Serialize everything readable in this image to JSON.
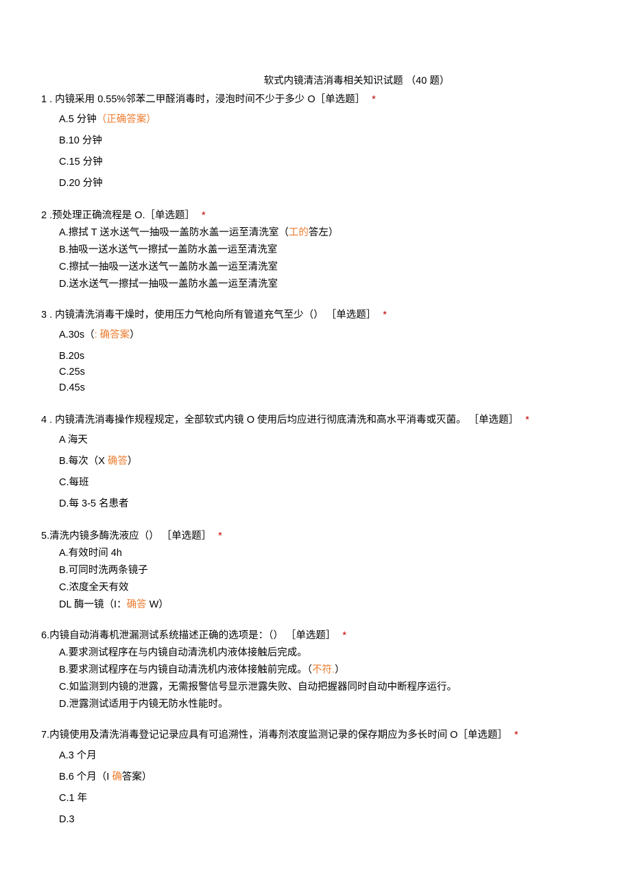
{
  "title_a": "软式内镜清洁消毒相关知识试题",
  "title_b": "（40 题）",
  "tag_single": "［单选题］",
  "star": "*",
  "q1": {
    "num": "1",
    "stem_a": " . 内镜采用 0.55%邻苯二甲醛消毒时，浸泡时间不少于多少 O",
    "a_pre": "A.5 分钟",
    "a_ans": "（正确答案）",
    "b": "B.10 分钟",
    "c": "C.15 分钟",
    "d": "D.20 分钟"
  },
  "q2": {
    "num": "2",
    "stem_a": "   .预处理正确流程是 O.",
    "a_pre": "A.擦拭 T 送水送气一抽吸一盖防水盖一运至清洗室（",
    "a_mid": "工的",
    "a_post": "答左）",
    "b": "B.抽吸一送水送气一擦拭一盖防水盖一运至清洗室",
    "c": "C.擦拭一抽吸一送水送气一盖防水盖一运至清洗室",
    "d": "D.送水送气一擦拭一抽吸一盖防水盖一运至清洗室"
  },
  "q3": {
    "num": "3",
    "stem_a": "   . 内镜清洗消毒干燥时，使用压力气枪向所有管道充气至少（） ［单选题］",
    "a_pre": "A.30s（",
    "a_mid": ":  确答案",
    "a_post": "）",
    "b": "B.20s",
    "c": "C.25s",
    "d": "D.45s"
  },
  "q4": {
    "num": "4",
    "stem_a": "   . 内镜清洗消毒操作规程规定，全部软式内镜 O 使用后均应进行彻底清洗和高水平消毒或灭菌。",
    "a": "A 海天",
    "b_pre": "B.每次（X ",
    "b_mid": "确答",
    "b_post": "）",
    "c": "C.每班",
    "d": "D.每 3-5 名患者"
  },
  "q5": {
    "stem": "5.清洗内镜多酶洗液应（） ［单选题］",
    "a": "A.有效时间 4h",
    "b": "B.可同时洗两条镜子",
    "c": "C.浓度全天有效",
    "d_pre": "DL 酶一镜（I：",
    "d_mid": "确答",
    "d_post": " W）"
  },
  "q6": {
    "stem": "6.内镜自动消毒机泄漏测试系统描述正确的选项是：（） ［单选题］",
    "a": "A.要求测试程序在与内镜自动清洗机内液体接触后完成。",
    "b_pre": "B.要求测试程序在与内镜自动清洗机内液体接触前完成。（",
    "b_mid": "不符.",
    "b_post": "）",
    "c": "C.如监测到内镜的泄露，无需报警信号显示泄露失败、自动把握器同时自动中断程序运行。",
    "d": "D.泄露测试适用于内镜无防水性能时。"
  },
  "q7": {
    "stem": "7.内镜使用及清洗消毒登记记录应具有可追溯性，消毒剂浓度监测记录的保存期应为多长时间 O",
    "a": "A.3 个月",
    "b_pre": "B.6 个月（I ",
    "b_mid": "确",
    "b_post": "答案）",
    "c": "C.1 年",
    "d": "D.3"
  }
}
